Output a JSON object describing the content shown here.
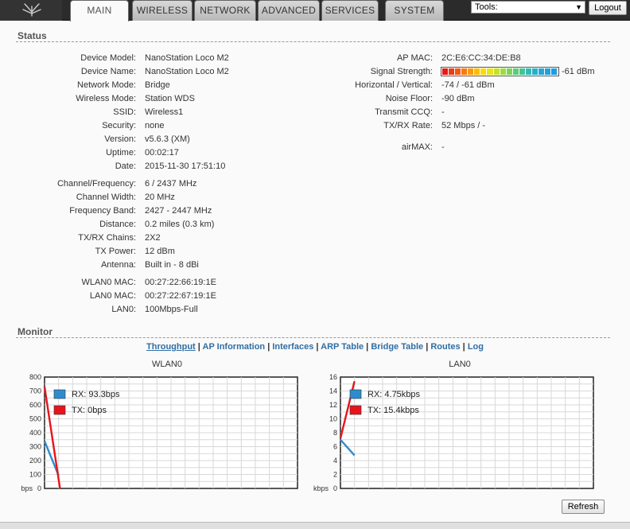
{
  "header": {
    "tabs": [
      {
        "label": "MAIN",
        "active": true
      },
      {
        "label": "WIRELESS"
      },
      {
        "label": "NETWORK"
      },
      {
        "label": "ADVANCED"
      },
      {
        "label": "SERVICES"
      },
      {
        "label": "SYSTEM"
      }
    ],
    "tools_value": "Tools:",
    "logout_label": "Logout"
  },
  "status": {
    "title": "Status",
    "left_group1": [
      {
        "label": "Device Model:",
        "value": "NanoStation Loco M2"
      },
      {
        "label": "Device Name:",
        "value": "NanoStation Loco M2"
      },
      {
        "label": "Network Mode:",
        "value": "Bridge"
      },
      {
        "label": "Wireless Mode:",
        "value": "Station WDS"
      },
      {
        "label": "SSID:",
        "value": "Wireless1"
      },
      {
        "label": "Security:",
        "value": "none"
      },
      {
        "label": "Version:",
        "value": "v5.6.3 (XM)"
      },
      {
        "label": "Uptime:",
        "value": "00:02:17"
      },
      {
        "label": "Date:",
        "value": "2015-11-30 17:51:10"
      }
    ],
    "left_group2": [
      {
        "label": "Channel/Frequency:",
        "value": "6 / 2437 MHz"
      },
      {
        "label": "Channel Width:",
        "value": "20 MHz"
      },
      {
        "label": "Frequency Band:",
        "value": "2427 - 2447 MHz"
      },
      {
        "label": "Distance:",
        "value": "0.2 miles (0.3 km)"
      },
      {
        "label": "TX/RX Chains:",
        "value": "2X2"
      },
      {
        "label": "TX Power:",
        "value": "12 dBm"
      },
      {
        "label": "Antenna:",
        "value": "Built in - 8 dBi"
      }
    ],
    "left_group3": [
      {
        "label": "WLAN0 MAC:",
        "value": "00:27:22:66:19:1E"
      },
      {
        "label": "LAN0 MAC:",
        "value": "00:27:22:67:19:1E"
      },
      {
        "label": "LAN0:",
        "value": "100Mbps-Full"
      }
    ],
    "right": {
      "ap_mac_label": "AP MAC:",
      "ap_mac": "2C:E6:CC:34:DE:B8",
      "signal_label": "Signal Strength:",
      "signal_value": "-61 dBm",
      "signal_segments": [
        "#e31b1b",
        "#ee3a17",
        "#f25a14",
        "#f77a11",
        "#fb9a0e",
        "#ffbb0b",
        "#ffd90a",
        "#e9e31a",
        "#c6e02a",
        "#9fdb3f",
        "#7ad457",
        "#5ccc78",
        "#45c297",
        "#36b8b3",
        "#2aaec8",
        "#25a6d4",
        "#22a0da",
        "#209cdd"
      ],
      "hv_label": "Horizontal / Vertical:",
      "hv_value": "-74 / -61 dBm",
      "noise_label": "Noise Floor:",
      "noise_value": "-90 dBm",
      "ccq_label": "Transmit CCQ:",
      "ccq_value": "-",
      "rate_label": "TX/RX Rate:",
      "rate_value": "52 Mbps / -",
      "airmax_label": "airMAX:",
      "airmax_value": "-"
    }
  },
  "monitor": {
    "title": "Monitor",
    "links": [
      {
        "label": "Throughput",
        "active": true
      },
      {
        "label": "AP Information"
      },
      {
        "label": "Interfaces"
      },
      {
        "label": "ARP Table"
      },
      {
        "label": "Bridge Table"
      },
      {
        "label": "Routes"
      },
      {
        "label": "Log"
      }
    ],
    "separator": "|",
    "refresh_label": "Refresh"
  },
  "chart_data": [
    {
      "type": "line",
      "title": "WLAN0",
      "unit": "bps",
      "yticks": [
        0,
        100,
        200,
        300,
        400,
        500,
        600,
        700,
        800
      ],
      "ylim": [
        0,
        800
      ],
      "series": [
        {
          "name": "RX: 93.3bps",
          "color": "#2e8ccd",
          "points": [
            [
              0,
              340
            ],
            [
              1,
              93.3
            ]
          ]
        },
        {
          "name": "TX: 0bps",
          "color": "#e8141b",
          "points": [
            [
              0,
              730
            ],
            [
              1.1,
              0
            ]
          ]
        }
      ]
    },
    {
      "type": "line",
      "title": "LAN0",
      "unit": "kbps",
      "yticks": [
        0,
        2,
        4,
        6,
        8,
        10,
        12,
        14,
        16
      ],
      "ylim": [
        0,
        16
      ],
      "series": [
        {
          "name": "RX: 4.75kbps",
          "color": "#2e8ccd",
          "points": [
            [
              0,
              7.0
            ],
            [
              1,
              4.75
            ]
          ]
        },
        {
          "name": "TX: 15.4kbps",
          "color": "#e8141b",
          "points": [
            [
              0,
              7.2
            ],
            [
              1,
              15.4
            ]
          ]
        }
      ]
    }
  ]
}
